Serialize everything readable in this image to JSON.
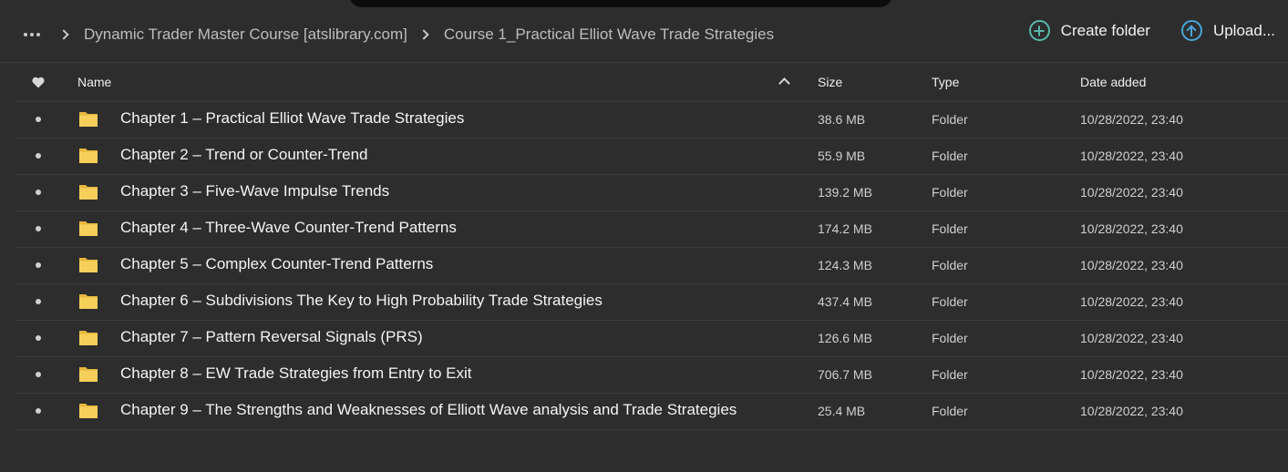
{
  "breadcrumb": {
    "items": [
      "Dynamic Trader Master Course [atslibrary.com]",
      "Course 1_Practical Elliot Wave Trade Strategies"
    ]
  },
  "actions": {
    "create_folder": "Create folder",
    "upload": "Upload..."
  },
  "columns": {
    "name": "Name",
    "size": "Size",
    "type": "Type",
    "date": "Date added"
  },
  "colors": {
    "background": "#2d2d2d",
    "create_accent": "#59b7a8",
    "upload_accent": "#4aa5d6",
    "folder": "#f2c94c"
  },
  "rows": [
    {
      "name": "Chapter 1 – Practical Elliot Wave Trade Strategies",
      "size": "38.6 MB",
      "type": "Folder",
      "date": "10/28/2022, 23:40"
    },
    {
      "name": "Chapter 2 – Trend or Counter-Trend",
      "size": "55.9 MB",
      "type": "Folder",
      "date": "10/28/2022, 23:40"
    },
    {
      "name": "Chapter 3 – Five-Wave Impulse Trends",
      "size": "139.2 MB",
      "type": "Folder",
      "date": "10/28/2022, 23:40"
    },
    {
      "name": "Chapter 4 – Three-Wave Counter-Trend Patterns",
      "size": "174.2 MB",
      "type": "Folder",
      "date": "10/28/2022, 23:40"
    },
    {
      "name": "Chapter 5 – Complex Counter-Trend Patterns",
      "size": "124.3 MB",
      "type": "Folder",
      "date": "10/28/2022, 23:40"
    },
    {
      "name": "Chapter 6 – Subdivisions The Key to High Probability Trade Strategies",
      "size": "437.4 MB",
      "type": "Folder",
      "date": "10/28/2022, 23:40"
    },
    {
      "name": "Chapter 7 – Pattern Reversal Signals (PRS)",
      "size": "126.6 MB",
      "type": "Folder",
      "date": "10/28/2022, 23:40"
    },
    {
      "name": "Chapter 8 – EW Trade Strategies from Entry to Exit",
      "size": "706.7 MB",
      "type": "Folder",
      "date": "10/28/2022, 23:40"
    },
    {
      "name": "Chapter 9 – The Strengths and Weaknesses of Elliott Wave analysis and Trade Strategies",
      "size": "25.4 MB",
      "type": "Folder",
      "date": "10/28/2022, 23:40"
    }
  ]
}
